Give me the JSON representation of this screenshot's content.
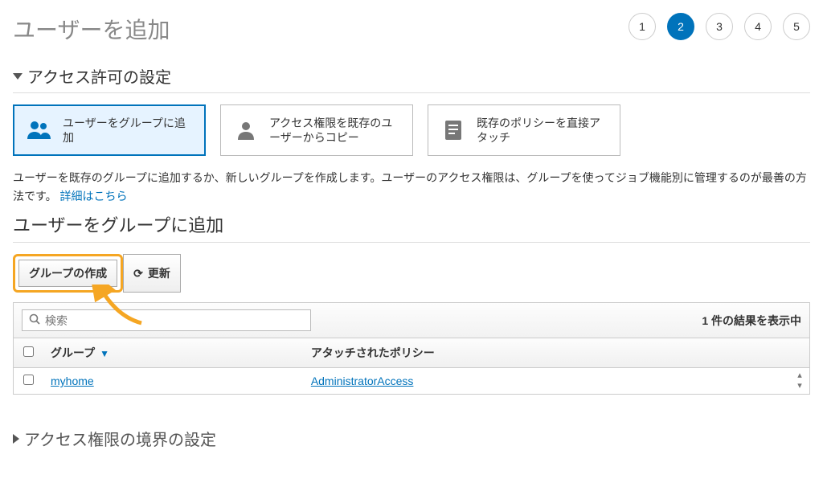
{
  "page_title": "ユーザーを追加",
  "stepper": {
    "steps": [
      "1",
      "2",
      "3",
      "4",
      "5"
    ],
    "active_index": 1
  },
  "section_permissions": "アクセス許可の設定",
  "tiles": [
    {
      "label": "ユーザーをグループに追加",
      "icon": "users"
    },
    {
      "label": "アクセス権限を既存のユーザーからコピー",
      "icon": "person"
    },
    {
      "label": "既存のポリシーを直接アタッチ",
      "icon": "document"
    }
  ],
  "description_text": "ユーザーを既存のグループに追加するか、新しいグループを作成します。ユーザーのアクセス権限は、グループを使ってジョブ機能別に管理するのが最善の方法です。 ",
  "learn_more": "詳細はこちら",
  "subsection_title": "ユーザーをグループに追加",
  "buttons": {
    "create_group": "グループの作成",
    "refresh": "更新"
  },
  "search": {
    "placeholder": "検索"
  },
  "result_count_text": "1 件の結果を表示中",
  "columns": {
    "group": "グループ",
    "policies": "アタッチされたポリシー"
  },
  "rows": [
    {
      "group": "myhome",
      "policies": "AdministratorAccess"
    }
  ],
  "section_boundary": "アクセス権限の境界の設定"
}
